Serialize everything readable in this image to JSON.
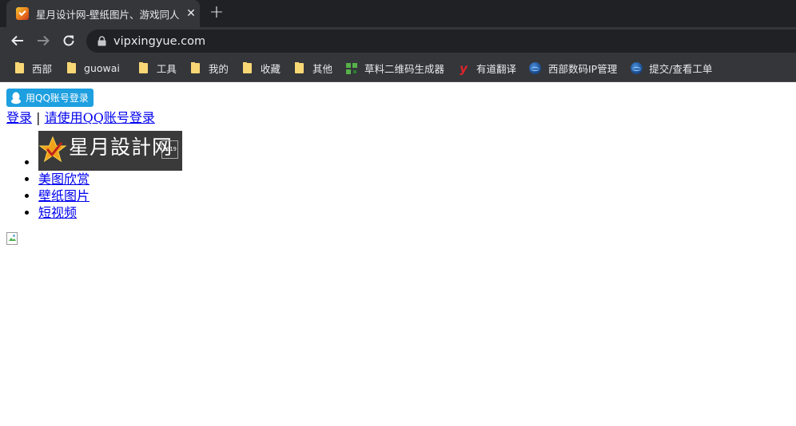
{
  "browser": {
    "tab_title": "星月设计网-壁纸图片、游戏同人",
    "tab_close": "✕",
    "new_tab": "+",
    "url": "vipxingyue.com"
  },
  "bookmarks": [
    {
      "label": "西部",
      "icon": "folder-icon"
    },
    {
      "label": "guowai",
      "icon": "folder-icon"
    },
    {
      "label": "工具",
      "icon": "folder-icon"
    },
    {
      "label": "我的",
      "icon": "folder-icon"
    },
    {
      "label": "收藏",
      "icon": "folder-icon"
    },
    {
      "label": "其他",
      "icon": "folder-icon"
    },
    {
      "label": "草料二维码生成器",
      "icon": "qr-code-icon"
    },
    {
      "label": "有道翻译",
      "icon": "youdao-icon",
      "glyph": "y"
    },
    {
      "label": "西部数码IP管理",
      "icon": "globe-icon"
    },
    {
      "label": "提交/查看工单",
      "icon": "globe-icon"
    }
  ],
  "page": {
    "qq_button_label": "用QQ账号登录",
    "login_link": "登录",
    "separator": "|",
    "qq_login_link": "请使用QQ账号登录",
    "logo_text": "星月設計网",
    "logo_year": "2019",
    "menu": [
      "美图欣赏",
      "壁纸图片",
      "短视频"
    ]
  },
  "colors": {
    "chrome_dark": "#202124",
    "chrome_toolbar": "#35363a",
    "qq_blue": "#1d9fe0",
    "link": "#0000ee"
  }
}
